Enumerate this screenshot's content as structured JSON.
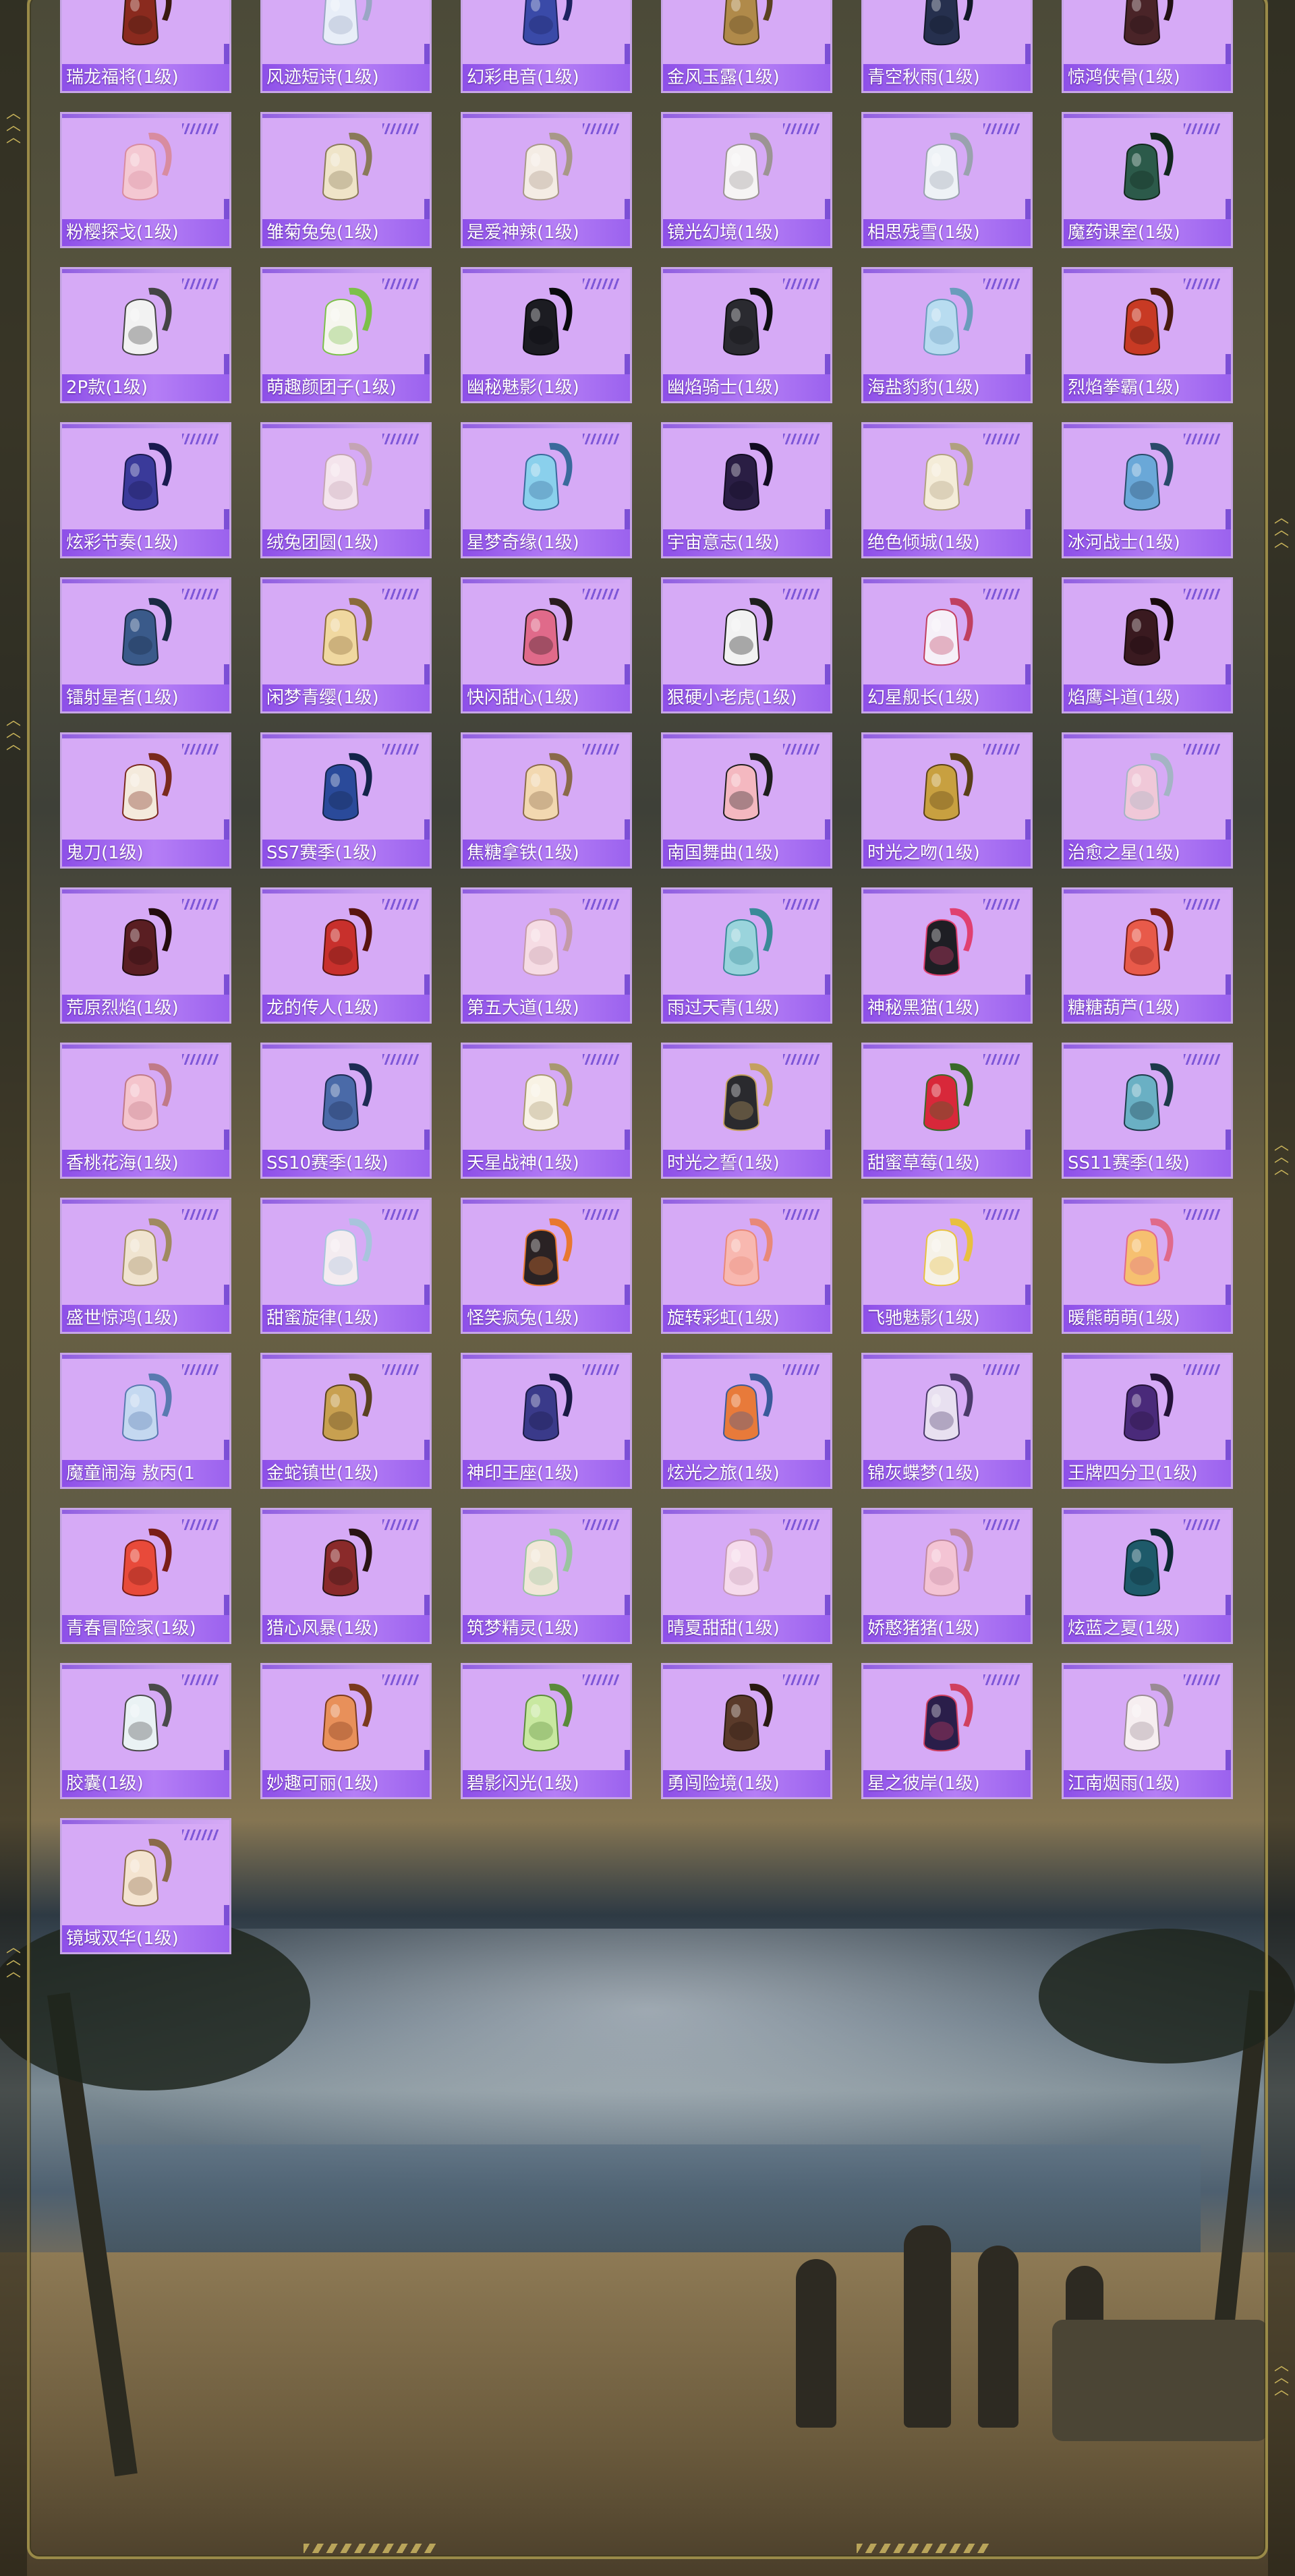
{
  "page": {
    "accent_color": "#b57ef6",
    "card_color": "#d6aaf6",
    "label_color": "#8d4fe8"
  },
  "items": [
    {
      "label": "瑞龙福将(1级)",
      "color": "#8a2a1e",
      "strap": "#3a1a10"
    },
    {
      "label": "风迹短诗(1级)",
      "color": "#e8eef8",
      "strap": "#9aa6c4"
    },
    {
      "label": "幻彩电音(1级)",
      "color": "#3a4aa8",
      "strap": "#1d2260"
    },
    {
      "label": "金风玉露(1级)",
      "color": "#b08a4a",
      "strap": "#5a4220"
    },
    {
      "label": "青空秋雨(1级)",
      "color": "#26304e",
      "strap": "#121828"
    },
    {
      "label": "惊鸿侠骨(1级)",
      "color": "#4a2428",
      "strap": "#221014"
    },
    {
      "label": "粉樱探戈(1级)",
      "color": "#f4c8d2",
      "strap": "#d88ca0"
    },
    {
      "label": "雏菊兔兔(1级)",
      "color": "#efe4c8",
      "strap": "#8a7a5a"
    },
    {
      "label": "是爱神辣(1级)",
      "color": "#f4ece4",
      "strap": "#a89888"
    },
    {
      "label": "镜光幻境(1级)",
      "color": "#f6f4f4",
      "strap": "#9c9494"
    },
    {
      "label": "相思残雪(1级)",
      "color": "#eef2f6",
      "strap": "#9aa2ae"
    },
    {
      "label": "魔药课室(1级)",
      "color": "#2c5a4a",
      "strap": "#12281e"
    },
    {
      "label": "2P款(1级)",
      "color": "#f2f2f2",
      "strap": "#444444"
    },
    {
      "label": "萌趣颜团子(1级)",
      "color": "#f6f6ee",
      "strap": "#7cc04a"
    },
    {
      "label": "幽秘魅影(1级)",
      "color": "#1c1c22",
      "strap": "#0a0a0e"
    },
    {
      "label": "幽焰骑士(1级)",
      "color": "#2a2a30",
      "strap": "#101014"
    },
    {
      "label": "海盐豹豹(1级)",
      "color": "#b8dcf0",
      "strap": "#6a9cbc"
    },
    {
      "label": "烈焰拳霸(1级)",
      "color": "#c83a24",
      "strap": "#4a1a10"
    },
    {
      "label": "炫彩节奏(1级)",
      "color": "#3a3a9a",
      "strap": "#1a1a50"
    },
    {
      "label": "绒兔团圆(1级)",
      "color": "#f4e4ec",
      "strap": "#c4a4b4"
    },
    {
      "label": "星梦奇缘(1级)",
      "color": "#8ad0ec",
      "strap": "#3a6a9c"
    },
    {
      "label": "宇宙意志(1级)",
      "color": "#2a1e44",
      "strap": "#120c22"
    },
    {
      "label": "绝色倾城(1级)",
      "color": "#f4ecd8",
      "strap": "#b0a080"
    },
    {
      "label": "冰河战士(1级)",
      "color": "#6aa8d8",
      "strap": "#2a4a6a"
    },
    {
      "label": "镭射星者(1级)",
      "color": "#3a5a8a",
      "strap": "#1a2a44"
    },
    {
      "label": "闲梦青缨(1级)",
      "color": "#f0d8a0",
      "strap": "#8a6a3a"
    },
    {
      "label": "快闪甜心(1级)",
      "color": "#e06a8a",
      "strap": "#2a1a1e"
    },
    {
      "label": "狠硬小老虎(1级)",
      "color": "#f2f2f2",
      "strap": "#1e1e1e"
    },
    {
      "label": "幻星舰长(1级)",
      "color": "#f6f0f8",
      "strap": "#c04060"
    },
    {
      "label": "焰鹰斗道(1级)",
      "color": "#3a1a20",
      "strap": "#1a0a0e"
    },
    {
      "label": "鬼刀(1级)",
      "color": "#f4eadc",
      "strap": "#7a2a1e"
    },
    {
      "label": "SS7赛季(1级)",
      "color": "#2a4a9a",
      "strap": "#14244a"
    },
    {
      "label": "焦糖拿铁(1级)",
      "color": "#f2d8b0",
      "strap": "#8a6a4a"
    },
    {
      "label": "南国舞曲(1级)",
      "color": "#f4b8c0",
      "strap": "#1e1e1e"
    },
    {
      "label": "时光之吻(1级)",
      "color": "#c8a040",
      "strap": "#5a4018"
    },
    {
      "label": "治愈之星(1级)",
      "color": "#f0c8d8",
      "strap": "#a4b4c4"
    },
    {
      "label": "荒原烈焰(1级)",
      "color": "#5a1e22",
      "strap": "#240c0e"
    },
    {
      "label": "龙的传人(1级)",
      "color": "#c8302c",
      "strap": "#5a1410"
    },
    {
      "label": "第五大道(1级)",
      "color": "#f6dce4",
      "strap": "#c49aa8"
    },
    {
      "label": "雨过天青(1级)",
      "color": "#9ad4dc",
      "strap": "#3a8a98"
    },
    {
      "label": "神秘黑猫(1级)",
      "color": "#1e1e24",
      "strap": "#e04070"
    },
    {
      "label": "糖糖葫芦(1级)",
      "color": "#e85a4a",
      "strap": "#7a1e18"
    },
    {
      "label": "香桃花海(1级)",
      "color": "#f4c4cc",
      "strap": "#c07a88"
    },
    {
      "label": "SS10赛季(1级)",
      "color": "#4a6aa8",
      "strap": "#1e2c54"
    },
    {
      "label": "天星战神(1级)",
      "color": "#f8f2e4",
      "strap": "#a89870"
    },
    {
      "label": "时光之誓(1级)",
      "color": "#2a2a2e",
      "strap": "#c4a060"
    },
    {
      "label": "甜蜜草莓(1级)",
      "color": "#d8283a",
      "strap": "#3a6a2a"
    },
    {
      "label": "SS11赛季(1级)",
      "color": "#6ab0c4",
      "strap": "#1e3a4a"
    },
    {
      "label": "盛世惊鸿(1级)",
      "color": "#f0e4d0",
      "strap": "#a08a60"
    },
    {
      "label": "甜蜜旋律(1级)",
      "color": "#f4ecf0",
      "strap": "#a8c4dc"
    },
    {
      "label": "怪笑疯兔(1级)",
      "color": "#2a2224",
      "strap": "#e87830"
    },
    {
      "label": "旋转彩虹(1级)",
      "color": "#f8b8b0",
      "strap": "#e88878"
    },
    {
      "label": "飞驰魅影(1级)",
      "color": "#f6f2e8",
      "strap": "#e8c040"
    },
    {
      "label": "暖熊萌萌(1级)",
      "color": "#f6c070",
      "strap": "#e06a8a"
    },
    {
      "label": "魔童闹海 敖丙(1",
      "color": "#c4d8f0",
      "strap": "#5a7ab0"
    },
    {
      "label": "金蛇镇世(1级)",
      "color": "#c8a050",
      "strap": "#5a4220"
    },
    {
      "label": "神印王座(1级)",
      "color": "#3a3a8a",
      "strap": "#1a1a44"
    },
    {
      "label": "炫光之旅(1级)",
      "color": "#e87a3a",
      "strap": "#3a5a9a"
    },
    {
      "label": "锦灰蝶梦(1级)",
      "color": "#e8e0f0",
      "strap": "#4a3a6a"
    },
    {
      "label": "王牌四分卫(1级)",
      "color": "#4a2a7a",
      "strap": "#241238"
    },
    {
      "label": "青春冒险家(1级)",
      "color": "#e84a3a",
      "strap": "#7a1e18"
    },
    {
      "label": "猎心风暴(1级)",
      "color": "#8a2a2a",
      "strap": "#2a1414"
    },
    {
      "label": "筑梦精灵(1级)",
      "color": "#f2e8d8",
      "strap": "#9ac4a0"
    },
    {
      "label": "晴夏甜甜(1级)",
      "color": "#f6dcec",
      "strap": "#c49ab4"
    },
    {
      "label": "娇憨猪猪(1级)",
      "color": "#f4c4d4",
      "strap": "#c08aa0"
    },
    {
      "label": "炫蓝之夏(1级)",
      "color": "#1e5a6a",
      "strap": "#0e2a34"
    },
    {
      "label": "胶囊(1级)",
      "color": "#eaf2f4",
      "strap": "#4a4a4a"
    },
    {
      "label": "妙趣可丽(1级)",
      "color": "#e8905a",
      "strap": "#7a3a1e"
    },
    {
      "label": "碧影闪光(1级)",
      "color": "#c8e8a0",
      "strap": "#5a8a3a"
    },
    {
      "label": "勇闯险境(1级)",
      "color": "#5a3a2a",
      "strap": "#2a1a12"
    },
    {
      "label": "星之彼岸(1级)",
      "color": "#2a1e4a",
      "strap": "#d04060"
    },
    {
      "label": "江南烟雨(1级)",
      "color": "#f6eef0",
      "strap": "#9a8a94"
    },
    {
      "label": "镜域双华(1级)",
      "color": "#f4e4d0",
      "strap": "#8a6a4a"
    }
  ]
}
